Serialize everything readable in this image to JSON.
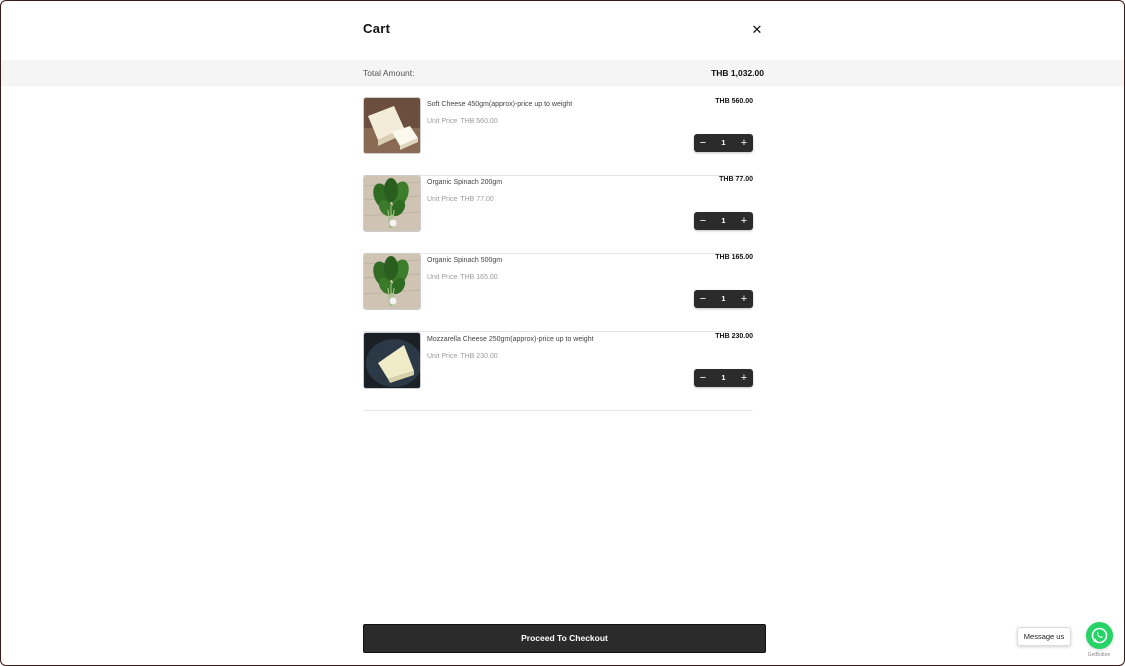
{
  "cart": {
    "title": "Cart",
    "close_icon": "close-icon",
    "total_label": "Total Amount:",
    "total_value": "THB 1,032.00",
    "unit_label": "Unit Price",
    "items": [
      {
        "name": "Soft Cheese 450gm(approx)-price up to weight",
        "unit_price": "THB 560.00",
        "price": "THB 560.00",
        "qty": "1",
        "image": "soft-cheese"
      },
      {
        "name": "Organic Spinach 200gm",
        "unit_price": "THB 77.00",
        "price": "THB 77.00",
        "qty": "1",
        "image": "spinach"
      },
      {
        "name": "Organic Spinach 500gm",
        "unit_price": "THB 165.00",
        "price": "THB 165.00",
        "qty": "1",
        "image": "spinach"
      },
      {
        "name": "Mozzarella Cheese 250gm(approx)-price up to weight",
        "unit_price": "THB 230.00",
        "price": "THB 230.00",
        "qty": "1",
        "image": "mozzarella"
      }
    ],
    "checkout_label": "Proceed To Checkout"
  },
  "widget": {
    "message_label": "Message us",
    "brand": "GetButton",
    "icon": "whatsapp-icon",
    "color": "#25d366"
  },
  "colors": {
    "accent": "#2b2b2b",
    "total_bar": "#f5f5f5"
  }
}
